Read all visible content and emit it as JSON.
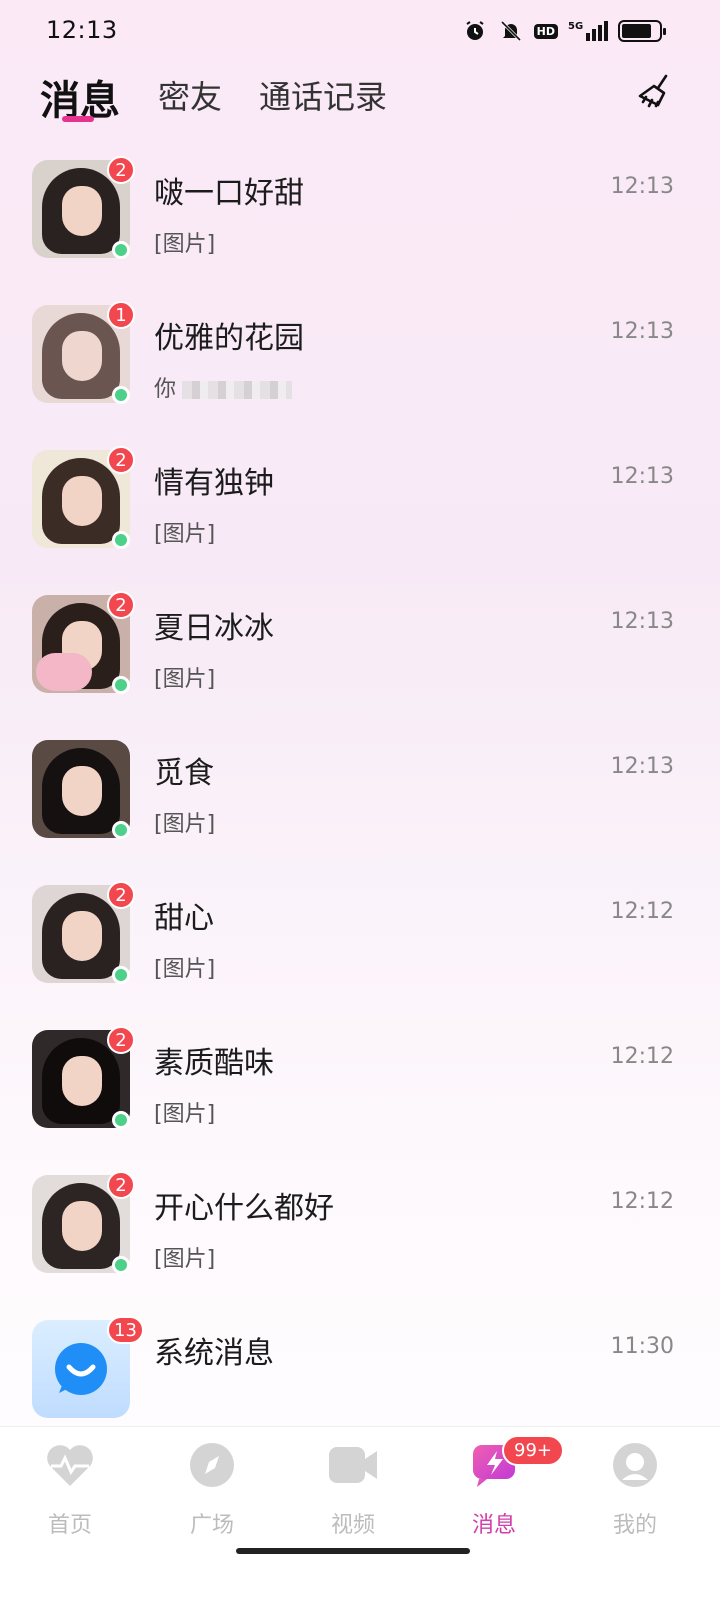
{
  "status_bar": {
    "time": "12:13",
    "network": "5G",
    "hd": "HD"
  },
  "header": {
    "tabs": [
      {
        "label": "消息"
      },
      {
        "label": "密友"
      },
      {
        "label": "通话记录"
      }
    ]
  },
  "conversations": [
    {
      "name": "啵一口好甜",
      "preview": "[图片]",
      "time": "12:13",
      "unread": "2"
    },
    {
      "name": "优雅的花园",
      "preview": "你",
      "time": "12:13",
      "unread": "1"
    },
    {
      "name": "情有独钟",
      "preview": "[图片]",
      "time": "12:13",
      "unread": "2"
    },
    {
      "name": "夏日冰冰",
      "preview": "[图片]",
      "time": "12:13",
      "unread": "2"
    },
    {
      "name": "觅食",
      "preview": "[图片]",
      "time": "12:13",
      "unread": ""
    },
    {
      "name": "甜心",
      "preview": "[图片]",
      "time": "12:12",
      "unread": "2"
    },
    {
      "name": "素质酷味",
      "preview": "[图片]",
      "time": "12:12",
      "unread": "2"
    },
    {
      "name": "开心什么都好",
      "preview": "[图片]",
      "time": "12:12",
      "unread": "2"
    },
    {
      "name": "系统消息",
      "preview": "",
      "time": "11:30",
      "unread": "13"
    }
  ],
  "bottom_nav": {
    "items": [
      {
        "label": "首页",
        "icon": "heartbeat-icon"
      },
      {
        "label": "广场",
        "icon": "compass-icon"
      },
      {
        "label": "视频",
        "icon": "video-camera-icon"
      },
      {
        "label": "消息",
        "icon": "lightning-chat-icon",
        "badge": "99+"
      },
      {
        "label": "我的",
        "icon": "profile-icon"
      }
    ]
  },
  "colors": {
    "accent": "#d23eaa",
    "badge": "#f2474f",
    "online": "#4cd08a",
    "tab_underline": "#e6338f"
  }
}
